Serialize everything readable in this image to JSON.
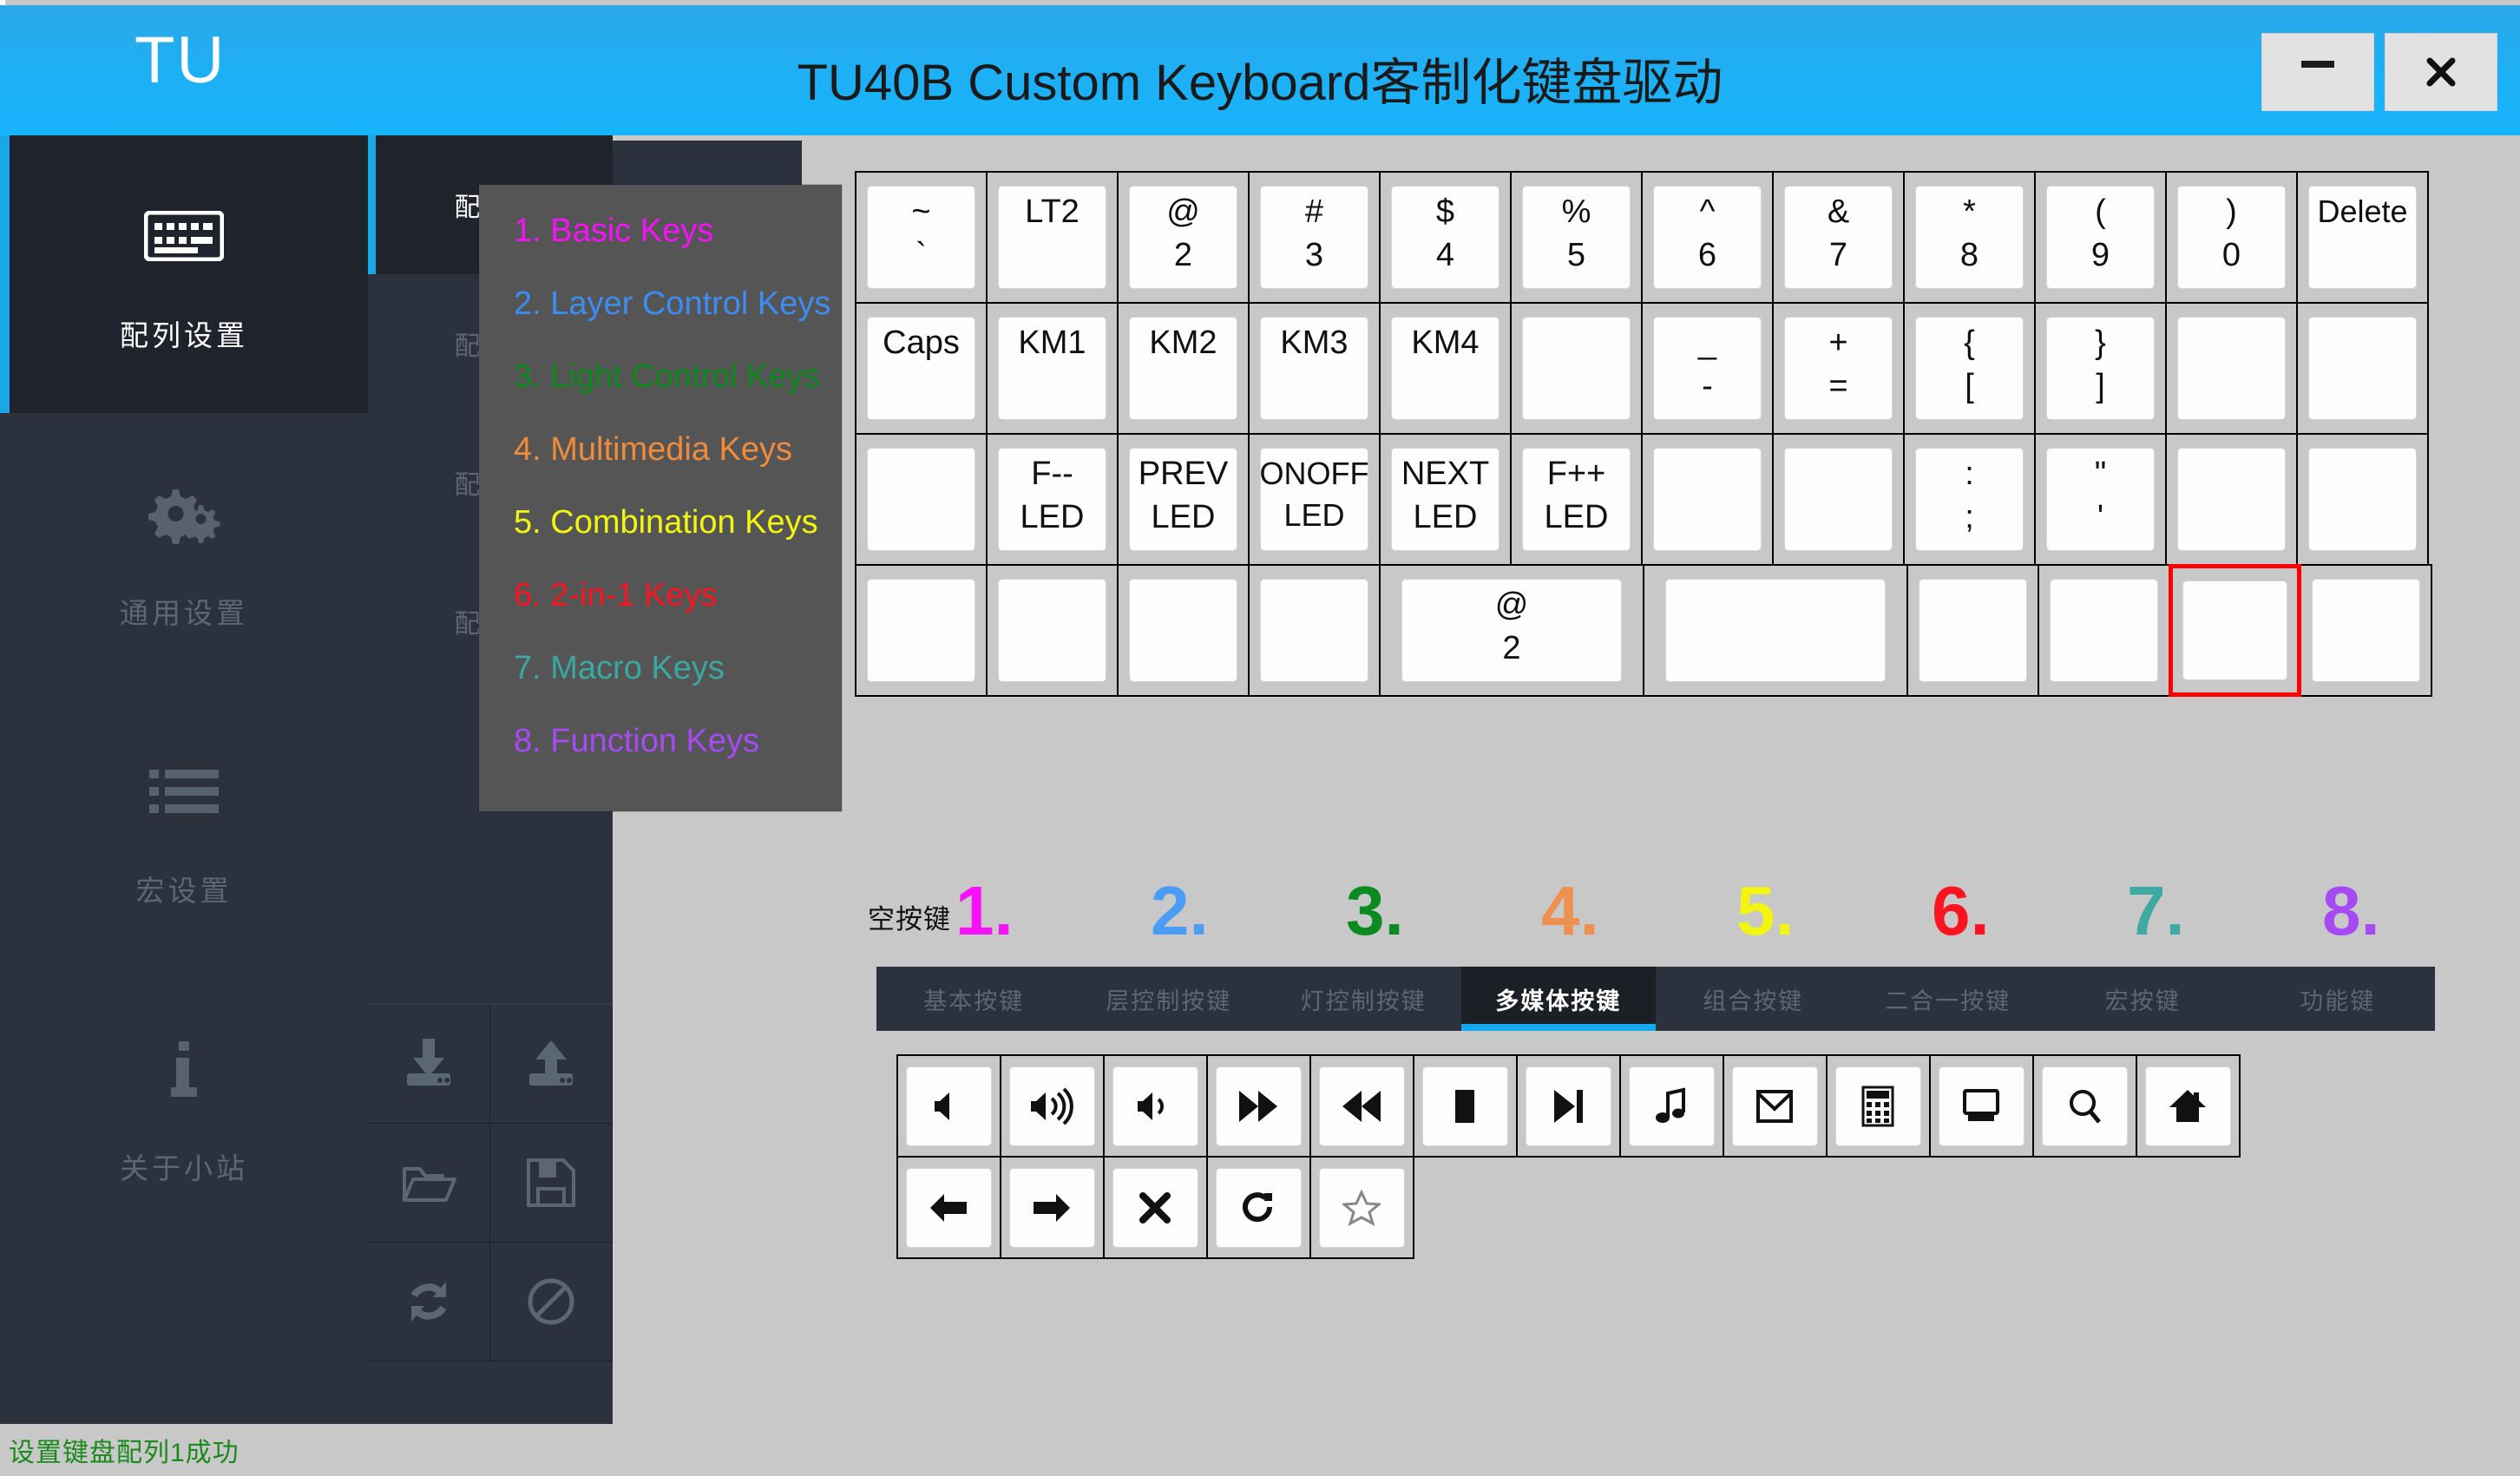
{
  "window": {
    "brand": "TU",
    "title": "TU40B Custom Keyboard客制化键盘驱动",
    "minimize_label": "—",
    "close_label": "✕",
    "accent_color": "#1aa7e8",
    "titlebar_color": "#21a7ef"
  },
  "sidebar": {
    "items": [
      {
        "label": "配列设置",
        "icon": "keyboard-icon",
        "active": true
      },
      {
        "label": "通用设置",
        "icon": "gears-icon",
        "active": false
      },
      {
        "label": "宏设置",
        "icon": "list-icon",
        "active": false
      },
      {
        "label": "关于小站",
        "icon": "info-icon",
        "active": false
      }
    ]
  },
  "layout_panel": {
    "header_label": "配列设置",
    "items": [
      {
        "label": "配列1",
        "active": true
      },
      {
        "label": "配列2",
        "active": false
      },
      {
        "label": "配列3",
        "active": false
      },
      {
        "label": "配列4",
        "active": false
      }
    ],
    "actions": [
      {
        "name": "download-from-keyboard",
        "icon": "download-icon"
      },
      {
        "name": "upload-to-keyboard",
        "icon": "upload-icon"
      },
      {
        "name": "open-file",
        "icon": "folder-open-icon"
      },
      {
        "name": "save-file",
        "icon": "floppy-save-icon"
      },
      {
        "name": "reset-sync",
        "icon": "refresh-icon"
      },
      {
        "name": "disable-clear",
        "icon": "ban-icon"
      }
    ]
  },
  "legend_popup": {
    "items": [
      {
        "label": "1. Basic Keys",
        "color": "#f612f6"
      },
      {
        "label": "2. Layer Control Keys",
        "color": "#3d8cf0"
      },
      {
        "label": "3. Light Control Keys",
        "color": "#0c8a1e"
      },
      {
        "label": "4. Multimedia Keys",
        "color": "#ef8b3c"
      },
      {
        "label": "5. Combination Keys",
        "color": "#f2f411"
      },
      {
        "label": "6. 2-in-1 Keys",
        "color": "#fb1420"
      },
      {
        "label": "7. Macro Keys",
        "color": "#3aa8a0"
      },
      {
        "label": "8. Function Keys",
        "color": "#a64bf4"
      }
    ]
  },
  "keyboard": {
    "rows": [
      [
        {
          "top": "~",
          "bottom": "`",
          "w": 1
        },
        {
          "top": "LT2",
          "bottom": "",
          "w": 1
        },
        {
          "top": "@",
          "bottom": "2",
          "w": 1
        },
        {
          "top": "#",
          "bottom": "3",
          "w": 1
        },
        {
          "top": "$",
          "bottom": "4",
          "w": 1
        },
        {
          "top": "%",
          "bottom": "5",
          "w": 1
        },
        {
          "top": "^",
          "bottom": "6",
          "w": 1
        },
        {
          "top": "&",
          "bottom": "7",
          "w": 1
        },
        {
          "top": "*",
          "bottom": "8",
          "w": 1
        },
        {
          "top": "(",
          "bottom": "9",
          "w": 1
        },
        {
          "top": ")",
          "bottom": "0",
          "w": 1
        },
        {
          "top": "Delete",
          "bottom": "",
          "w": 1
        }
      ],
      [
        {
          "top": "Caps",
          "bottom": "",
          "w": 1
        },
        {
          "top": "KM1",
          "bottom": "",
          "w": 1
        },
        {
          "top": "KM2",
          "bottom": "",
          "w": 1
        },
        {
          "top": "KM3",
          "bottom": "",
          "w": 1
        },
        {
          "top": "KM4",
          "bottom": "",
          "w": 1
        },
        {
          "top": "",
          "bottom": "",
          "w": 1
        },
        {
          "top": "_",
          "bottom": "-",
          "w": 1
        },
        {
          "top": "+",
          "bottom": "=",
          "w": 1
        },
        {
          "top": "{",
          "bottom": "[",
          "w": 1
        },
        {
          "top": "}",
          "bottom": "]",
          "w": 1
        },
        {
          "top": "",
          "bottom": "",
          "w": 1
        },
        {
          "top": "",
          "bottom": "",
          "w": 1
        }
      ],
      [
        {
          "top": "",
          "bottom": "",
          "w": 1
        },
        {
          "top": "F--",
          "bottom": "LED",
          "w": 1
        },
        {
          "top": "PREV",
          "bottom": "LED",
          "w": 1
        },
        {
          "top": "ONOFF",
          "bottom": "LED",
          "w": 1
        },
        {
          "top": "NEXT",
          "bottom": "LED",
          "w": 1
        },
        {
          "top": "F++",
          "bottom": "LED",
          "w": 1
        },
        {
          "top": "",
          "bottom": "",
          "w": 1
        },
        {
          "top": "",
          "bottom": "",
          "w": 1
        },
        {
          "top": ":",
          "bottom": ";",
          "w": 1
        },
        {
          "top": "\"",
          "bottom": "'",
          "w": 1
        },
        {
          "top": "",
          "bottom": "",
          "w": 1
        },
        {
          "top": "",
          "bottom": "",
          "w": 1
        }
      ],
      [
        {
          "top": "",
          "bottom": "",
          "w": 1
        },
        {
          "top": "",
          "bottom": "",
          "w": 1
        },
        {
          "top": "",
          "bottom": "",
          "w": 1
        },
        {
          "top": "",
          "bottom": "",
          "w": 1
        },
        {
          "top": "@",
          "bottom": "2",
          "w": 2
        },
        {
          "top": "",
          "bottom": "",
          "w": 2
        },
        {
          "top": "",
          "bottom": "",
          "w": 1
        },
        {
          "top": "",
          "bottom": "",
          "w": 1
        },
        {
          "top": "",
          "bottom": "",
          "w": 1,
          "selected": true
        },
        {
          "top": "",
          "bottom": "",
          "w": 1
        }
      ]
    ]
  },
  "legend_strip": {
    "empty_key_label": "空按键",
    "numbers": [
      {
        "label": "1.",
        "color": "#f612f6"
      },
      {
        "label": "2.",
        "color": "#4b9cf5"
      },
      {
        "label": "3.",
        "color": "#0b8a20"
      },
      {
        "label": "4.",
        "color": "#ee9050"
      },
      {
        "label": "5.",
        "color": "#f4f411"
      },
      {
        "label": "6.",
        "color": "#fb1420"
      },
      {
        "label": "7.",
        "color": "#3fa9a2"
      },
      {
        "label": "8.",
        "color": "#a64bf4"
      }
    ]
  },
  "tabs": [
    {
      "label": "基本按键",
      "active": false
    },
    {
      "label": "层控制按键",
      "active": false
    },
    {
      "label": "灯控制按键",
      "active": false
    },
    {
      "label": "多媒体按键",
      "active": true
    },
    {
      "label": "组合按键",
      "active": false
    },
    {
      "label": "二合一按键",
      "active": false
    },
    {
      "label": "宏按键",
      "active": false
    },
    {
      "label": "功能键",
      "active": false
    }
  ],
  "palette": {
    "rows": [
      [
        {
          "icon": "mute-icon"
        },
        {
          "icon": "volume-up-icon"
        },
        {
          "icon": "volume-down-icon"
        },
        {
          "icon": "next-track-icon"
        },
        {
          "icon": "prev-track-icon"
        },
        {
          "icon": "stop-icon"
        },
        {
          "icon": "play-pause-icon"
        },
        {
          "icon": "media-player-icon"
        },
        {
          "icon": "email-icon"
        },
        {
          "icon": "calculator-icon"
        },
        {
          "icon": "my-computer-icon"
        },
        {
          "icon": "search-icon"
        },
        {
          "icon": "home-icon"
        }
      ],
      [
        {
          "icon": "browser-back-icon"
        },
        {
          "icon": "browser-forward-icon"
        },
        {
          "icon": "browser-stop-icon"
        },
        {
          "icon": "browser-refresh-icon"
        },
        {
          "icon": "favorites-star-icon"
        }
      ]
    ]
  },
  "status": {
    "message": "设置键盘配列1成功",
    "color": "#1a8a1a"
  }
}
